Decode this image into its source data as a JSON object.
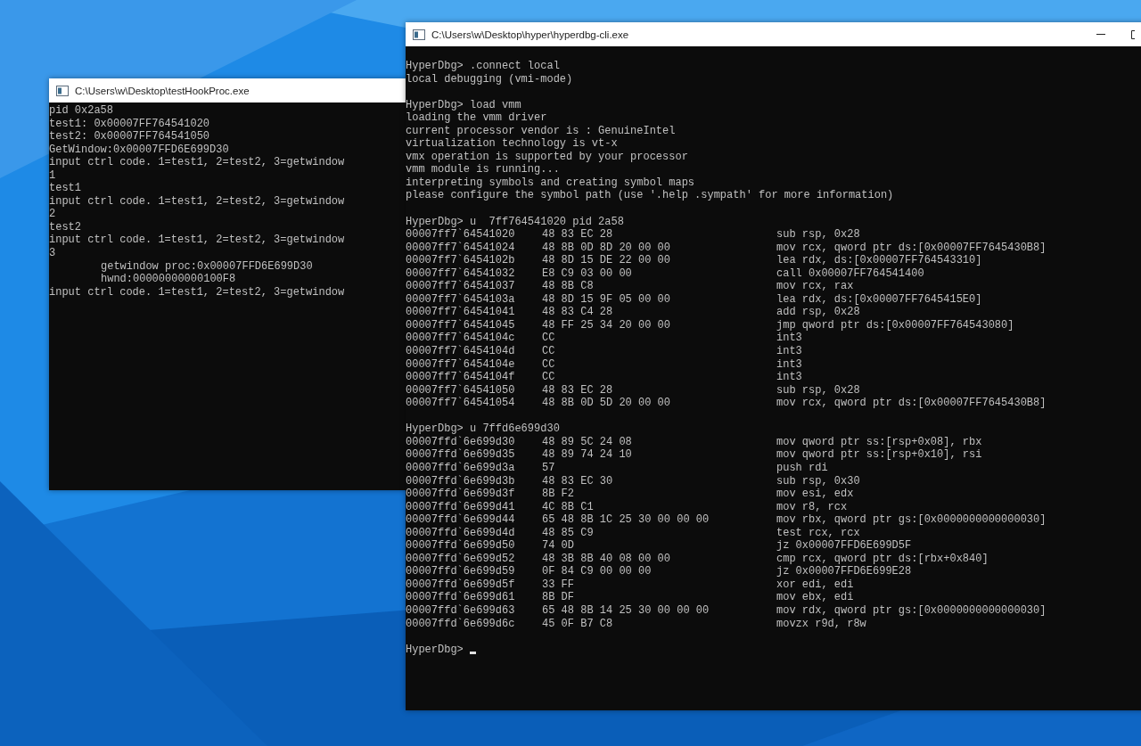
{
  "windows": [
    {
      "title": "C:\\Users\\w\\Desktop\\testHookProc.exe",
      "blocks": [
        {
          "kind": "text",
          "lines": [
            {
              "text": "pid 0x2a58",
              "indented": false
            },
            {
              "text": "test1: 0x00007FF764541020",
              "indented": false
            },
            {
              "text": "test2: 0x00007FF764541050",
              "indented": false
            },
            {
              "text": "GetWindow:0x00007FFD6E699D30",
              "indented": false
            },
            {
              "text": "input ctrl code. 1=test1, 2=test2, 3=getwindow",
              "indented": false
            },
            {
              "text": "1",
              "indented": false
            },
            {
              "text": "test1",
              "indented": false
            },
            {
              "text": "input ctrl code. 1=test1, 2=test2, 3=getwindow",
              "indented": false
            },
            {
              "text": "2",
              "indented": false
            },
            {
              "text": "test2",
              "indented": false
            },
            {
              "text": "input ctrl code. 1=test1, 2=test2, 3=getwindow",
              "indented": false
            },
            {
              "text": "3",
              "indented": false
            },
            {
              "text": "getwindow proc:0x00007FFD6E699D30",
              "indented": true
            },
            {
              "text": "hwnd:00000000000100F8",
              "indented": true
            },
            {
              "text": "input ctrl code. 1=test1, 2=test2, 3=getwindow",
              "indented": false
            }
          ]
        }
      ]
    },
    {
      "title": "C:\\Users\\w\\Desktop\\hyper\\hyperdbg-cli.exe",
      "blocks": [
        {
          "kind": "text",
          "lines": [
            {
              "text": "HyperDbg> .connect local",
              "indented": false
            },
            {
              "text": "local debugging (vmi-mode)",
              "indented": false
            }
          ]
        },
        {
          "kind": "text",
          "lines": [
            {
              "text": "HyperDbg> load vmm",
              "indented": false
            },
            {
              "text": "loading the vmm driver",
              "indented": false
            },
            {
              "text": "current processor vendor is : GenuineIntel",
              "indented": false
            },
            {
              "text": "virtualization technology is vt-x",
              "indented": false
            },
            {
              "text": "vmx operation is supported by your processor",
              "indented": false
            },
            {
              "text": "vmm module is running...",
              "indented": false
            },
            {
              "text": "interpreting symbols and creating symbol maps",
              "indented": false
            },
            {
              "text": "please configure the symbol path (use '.help .sympath' for more information)",
              "indented": false
            }
          ]
        },
        {
          "kind": "disasm",
          "command": "HyperDbg> u  7ff764541020 pid 2a58",
          "rows": [
            {
              "address": "00007ff7`64541020",
              "bytes": "48 83 EC 28",
              "instruction": "sub rsp, 0x28"
            },
            {
              "address": "00007ff7`64541024",
              "bytes": "48 8B 0D 8D 20 00 00",
              "instruction": "mov rcx, qword ptr ds:[0x00007FF7645430B8]"
            },
            {
              "address": "00007ff7`6454102b",
              "bytes": "48 8D 15 DE 22 00 00",
              "instruction": "lea rdx, ds:[0x00007FF764543310]"
            },
            {
              "address": "00007ff7`64541032",
              "bytes": "E8 C9 03 00 00",
              "instruction": "call 0x00007FF764541400"
            },
            {
              "address": "00007ff7`64541037",
              "bytes": "48 8B C8",
              "instruction": "mov rcx, rax"
            },
            {
              "address": "00007ff7`6454103a",
              "bytes": "48 8D 15 9F 05 00 00",
              "instruction": "lea rdx, ds:[0x00007FF7645415E0]"
            },
            {
              "address": "00007ff7`64541041",
              "bytes": "48 83 C4 28",
              "instruction": "add rsp, 0x28"
            },
            {
              "address": "00007ff7`64541045",
              "bytes": "48 FF 25 34 20 00 00",
              "instruction": "jmp qword ptr ds:[0x00007FF764543080]"
            },
            {
              "address": "00007ff7`6454104c",
              "bytes": "CC",
              "instruction": "int3"
            },
            {
              "address": "00007ff7`6454104d",
              "bytes": "CC",
              "instruction": "int3"
            },
            {
              "address": "00007ff7`6454104e",
              "bytes": "CC",
              "instruction": "int3"
            },
            {
              "address": "00007ff7`6454104f",
              "bytes": "CC",
              "instruction": "int3"
            },
            {
              "address": "00007ff7`64541050",
              "bytes": "48 83 EC 28",
              "instruction": "sub rsp, 0x28"
            },
            {
              "address": "00007ff7`64541054",
              "bytes": "48 8B 0D 5D 20 00 00",
              "instruction": "mov rcx, qword ptr ds:[0x00007FF7645430B8]"
            }
          ]
        },
        {
          "kind": "disasm",
          "command": "HyperDbg> u 7ffd6e699d30",
          "rows": [
            {
              "address": "00007ffd`6e699d30",
              "bytes": "48 89 5C 24 08",
              "instruction": "mov qword ptr ss:[rsp+0x08], rbx"
            },
            {
              "address": "00007ffd`6e699d35",
              "bytes": "48 89 74 24 10",
              "instruction": "mov qword ptr ss:[rsp+0x10], rsi"
            },
            {
              "address": "00007ffd`6e699d3a",
              "bytes": "57",
              "instruction": "push rdi"
            },
            {
              "address": "00007ffd`6e699d3b",
              "bytes": "48 83 EC 30",
              "instruction": "sub rsp, 0x30"
            },
            {
              "address": "00007ffd`6e699d3f",
              "bytes": "8B F2",
              "instruction": "mov esi, edx"
            },
            {
              "address": "00007ffd`6e699d41",
              "bytes": "4C 8B C1",
              "instruction": "mov r8, rcx"
            },
            {
              "address": "00007ffd`6e699d44",
              "bytes": "65 48 8B 1C 25 30 00 00 00",
              "instruction": "mov rbx, qword ptr gs:[0x0000000000000030]"
            },
            {
              "address": "00007ffd`6e699d4d",
              "bytes": "48 85 C9",
              "instruction": "test rcx, rcx"
            },
            {
              "address": "00007ffd`6e699d50",
              "bytes": "74 0D",
              "instruction": "jz 0x00007FFD6E699D5F"
            },
            {
              "address": "00007ffd`6e699d52",
              "bytes": "48 3B 8B 40 08 00 00",
              "instruction": "cmp rcx, qword ptr ds:[rbx+0x840]"
            },
            {
              "address": "00007ffd`6e699d59",
              "bytes": "0F 84 C9 00 00 00",
              "instruction": "jz 0x00007FFD6E699E28"
            },
            {
              "address": "00007ffd`6e699d5f",
              "bytes": "33 FF",
              "instruction": "xor edi, edi"
            },
            {
              "address": "00007ffd`6e699d61",
              "bytes": "8B DF",
              "instruction": "mov ebx, edi"
            },
            {
              "address": "00007ffd`6e699d63",
              "bytes": "65 48 8B 14 25 30 00 00 00",
              "instruction": "mov rdx, qword ptr gs:[0x0000000000000030]"
            },
            {
              "address": "00007ffd`6e699d6c",
              "bytes": "45 0F B7 C8",
              "instruction": "movzx r9d, r8w"
            }
          ]
        },
        {
          "kind": "prompt",
          "text": "HyperDbg>",
          "cursor": true
        }
      ]
    }
  ]
}
